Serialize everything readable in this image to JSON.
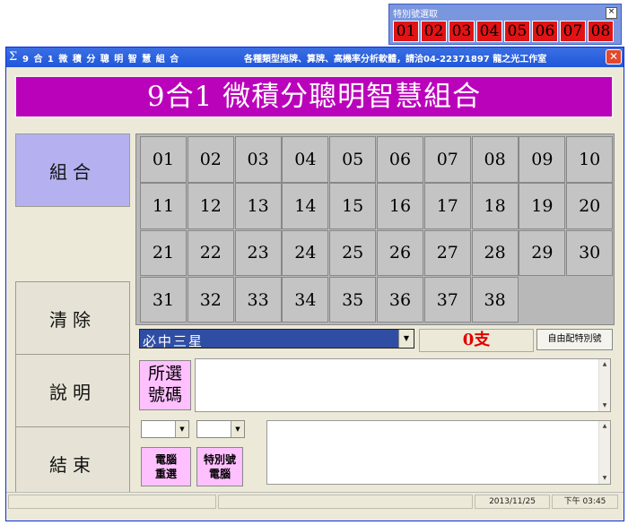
{
  "float_window": {
    "title": "特別號選取",
    "close_label": "×",
    "numbers": [
      "01",
      "02",
      "03",
      "04",
      "05",
      "06",
      "07",
      "08"
    ]
  },
  "window": {
    "icon": "Σ",
    "title": "9 合 1 微 積 分 聰 明 智 慧 組 合",
    "subtitle": "各種類型拖牌、算牌、高機率分析軟體，請洽04-22371897 龍之光工作室",
    "close_label": "✕"
  },
  "banner": {
    "text": "9合1 微積分聰明智慧組合"
  },
  "sidebar": {
    "combine": "組合",
    "clear": "清除",
    "help": "說明",
    "exit": "結束"
  },
  "numbers": [
    "01",
    "02",
    "03",
    "04",
    "05",
    "06",
    "07",
    "08",
    "09",
    "10",
    "11",
    "12",
    "13",
    "14",
    "15",
    "16",
    "17",
    "18",
    "19",
    "20",
    "21",
    "22",
    "23",
    "24",
    "25",
    "26",
    "27",
    "28",
    "29",
    "30",
    "31",
    "32",
    "33",
    "34",
    "35",
    "36",
    "37",
    "38"
  ],
  "combo": {
    "value": "必中三星",
    "arrow": "▼"
  },
  "count": {
    "text": "0支"
  },
  "free_special_button": "自由配特別號",
  "selected": {
    "label_line1": "所選",
    "label_line2": "號碼"
  },
  "selects": {
    "arrow": "▼"
  },
  "buttons": {
    "computer_pick_l1": "電腦",
    "computer_pick_l2": "重選",
    "special_computer_l1": "特別號",
    "special_computer_l2": "電腦"
  },
  "scroll": {
    "up": "▲",
    "down": "▼"
  },
  "statusbar": {
    "date": "2013/11/25",
    "time": "下午 03:45"
  },
  "colors": {
    "banner": "#bb02bb",
    "highlight_button": "#b5b1f0",
    "pink_button": "#ffc0ff",
    "special_red": "#e01414",
    "count_red": "#e00000"
  }
}
